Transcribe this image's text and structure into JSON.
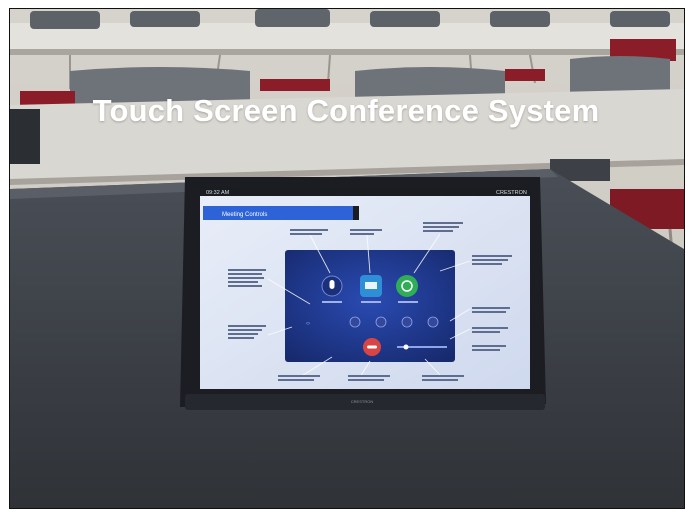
{
  "caption": {
    "title": "Touch Screen  Conference System"
  },
  "tablet": {
    "time": "09:32 AM",
    "brand": "CRESTRON",
    "panel_title": "Meeting Controls",
    "footer_brand": "CRESTRON"
  },
  "colors": {
    "screen_blue": "#1f3a8f",
    "header_blue": "#2d63d6",
    "share_button": "#2e8fd6",
    "join_button": "#2fae57",
    "end_button": "#d94545",
    "bezel": "#1b1d22"
  }
}
